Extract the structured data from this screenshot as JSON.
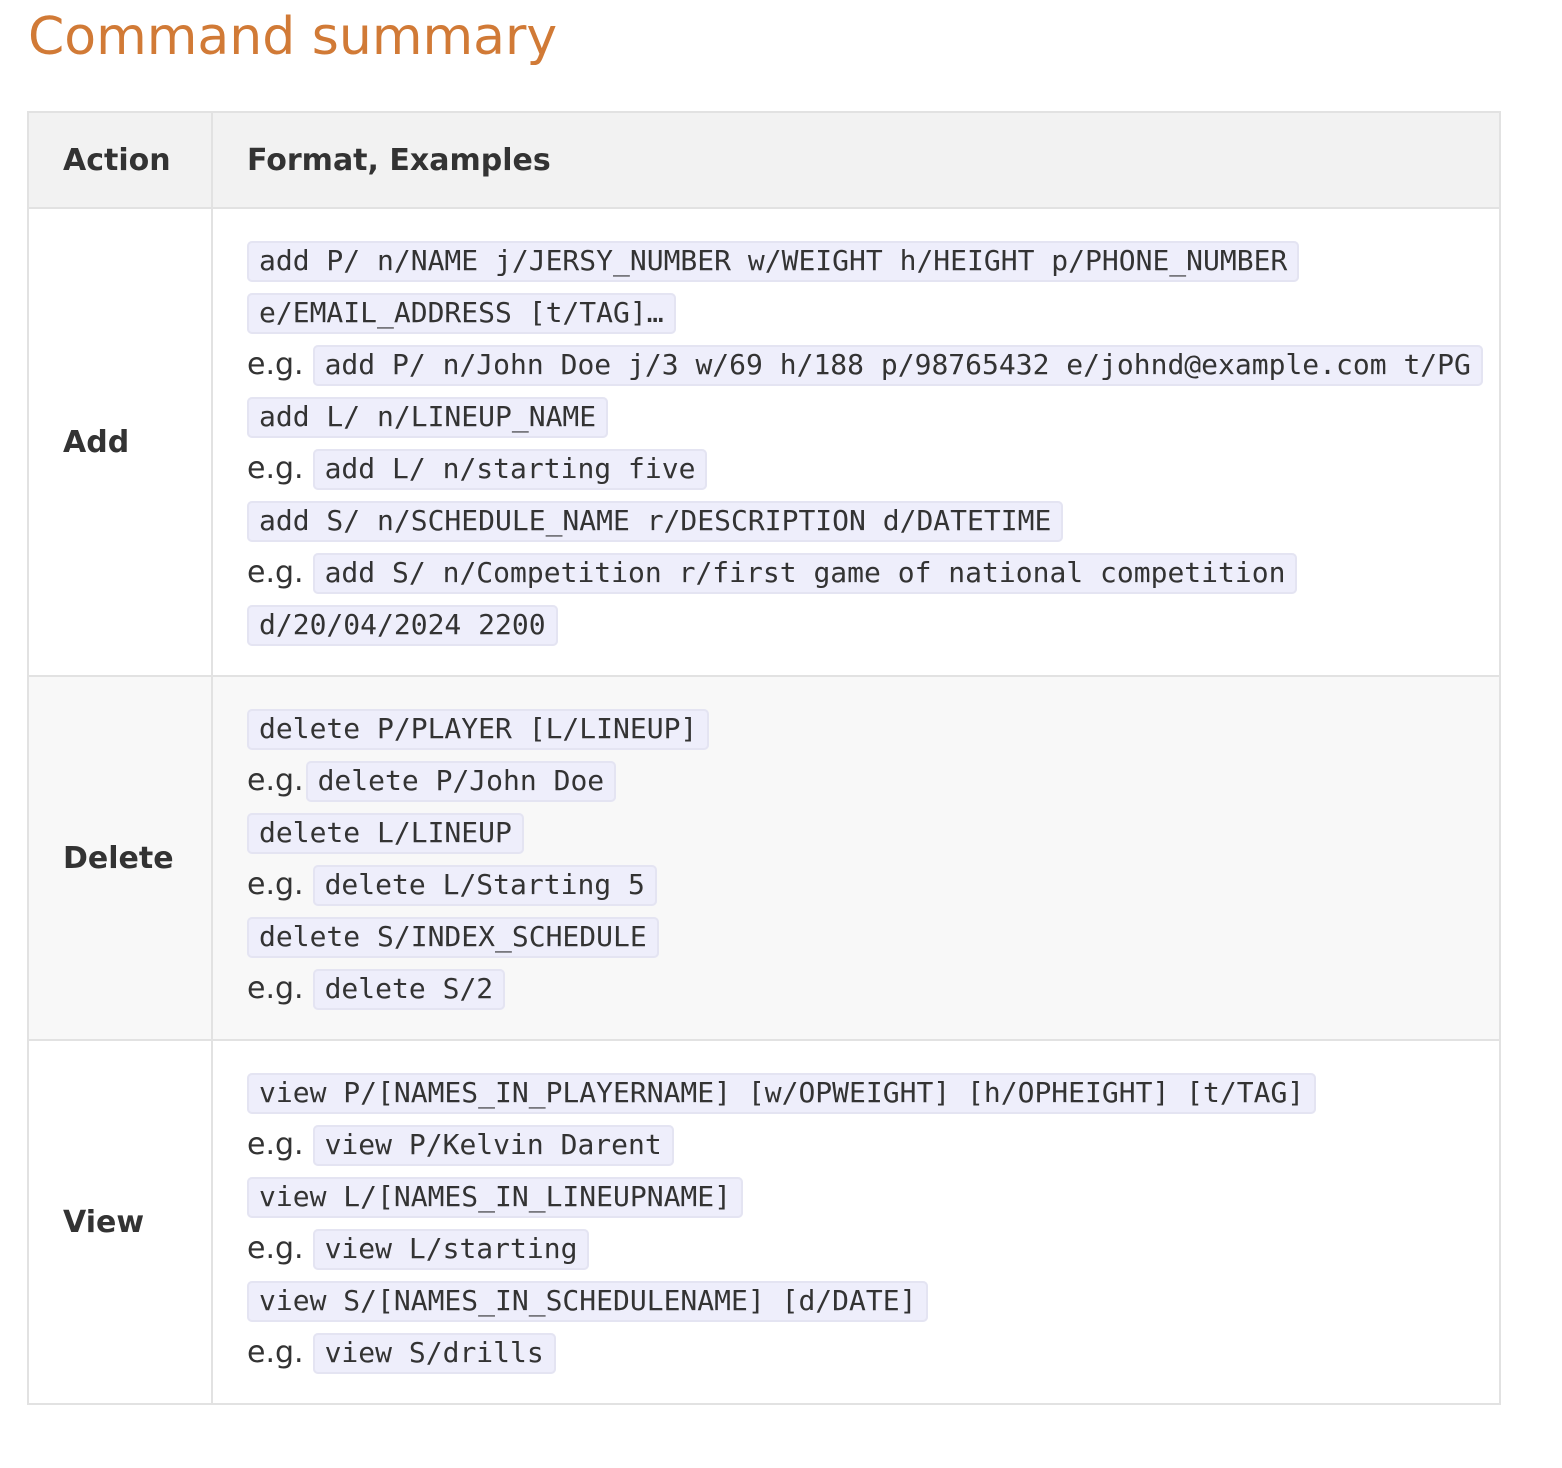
{
  "page": {
    "title": "Command summary"
  },
  "table": {
    "headers": {
      "action": "Action",
      "format": "Format, Examples"
    },
    "eg_label": "e.g.",
    "rows": [
      {
        "action": "Add",
        "lines": [
          {
            "type": "format",
            "code": "add P/ n/NAME j/JERSY_NUMBER w/WEIGHT h/HEIGHT p/PHONE_NUMBER e/EMAIL_ADDRESS [t/TAG]…"
          },
          {
            "type": "example",
            "code": "add P/ n/John Doe j/3 w/69 h/188 p/98765432 e/johnd@example.com t/PG"
          },
          {
            "type": "format",
            "code": "add L/ n/LINEUP_NAME"
          },
          {
            "type": "example",
            "code": "add L/ n/starting five"
          },
          {
            "type": "format",
            "code": "add S/ n/SCHEDULE_NAME r/DESCRIPTION d/DATETIME"
          },
          {
            "type": "example",
            "code": "add S/ n/Competition r/first game of national competition d/20/04/2024 2200"
          }
        ]
      },
      {
        "action": "Delete",
        "lines": [
          {
            "type": "format",
            "code": "delete P/PLAYER [L/LINEUP]"
          },
          {
            "type": "example",
            "code": "delete P/John Doe"
          },
          {
            "type": "format",
            "code": "delete L/LINEUP"
          },
          {
            "type": "example",
            "code": "delete L/Starting 5"
          },
          {
            "type": "format",
            "code": "delete S/INDEX_SCHEDULE"
          },
          {
            "type": "example",
            "code": "delete S/2"
          }
        ]
      },
      {
        "action": "View",
        "lines": [
          {
            "type": "format",
            "code": "view P/[NAMES_IN_PLAYERNAME] [w/OPWEIGHT] [h/OPHEIGHT] [t/TAG]"
          },
          {
            "type": "example",
            "code": "view P/Kelvin Darent"
          },
          {
            "type": "format",
            "code": "view L/[NAMES_IN_LINEUPNAME]"
          },
          {
            "type": "example",
            "code": "view L/starting"
          },
          {
            "type": "format",
            "code": "view S/[NAMES_IN_SCHEDULENAME] [d/DATE]"
          },
          {
            "type": "example",
            "code": "view S/drills"
          }
        ]
      }
    ]
  },
  "colors": {
    "title": "#d17a36",
    "header_background": "#f2f2f2",
    "alt_row_background": "#f8f8f8",
    "code_background": "#eeeefb",
    "border": "#e2e2e2",
    "text": "#333333"
  }
}
